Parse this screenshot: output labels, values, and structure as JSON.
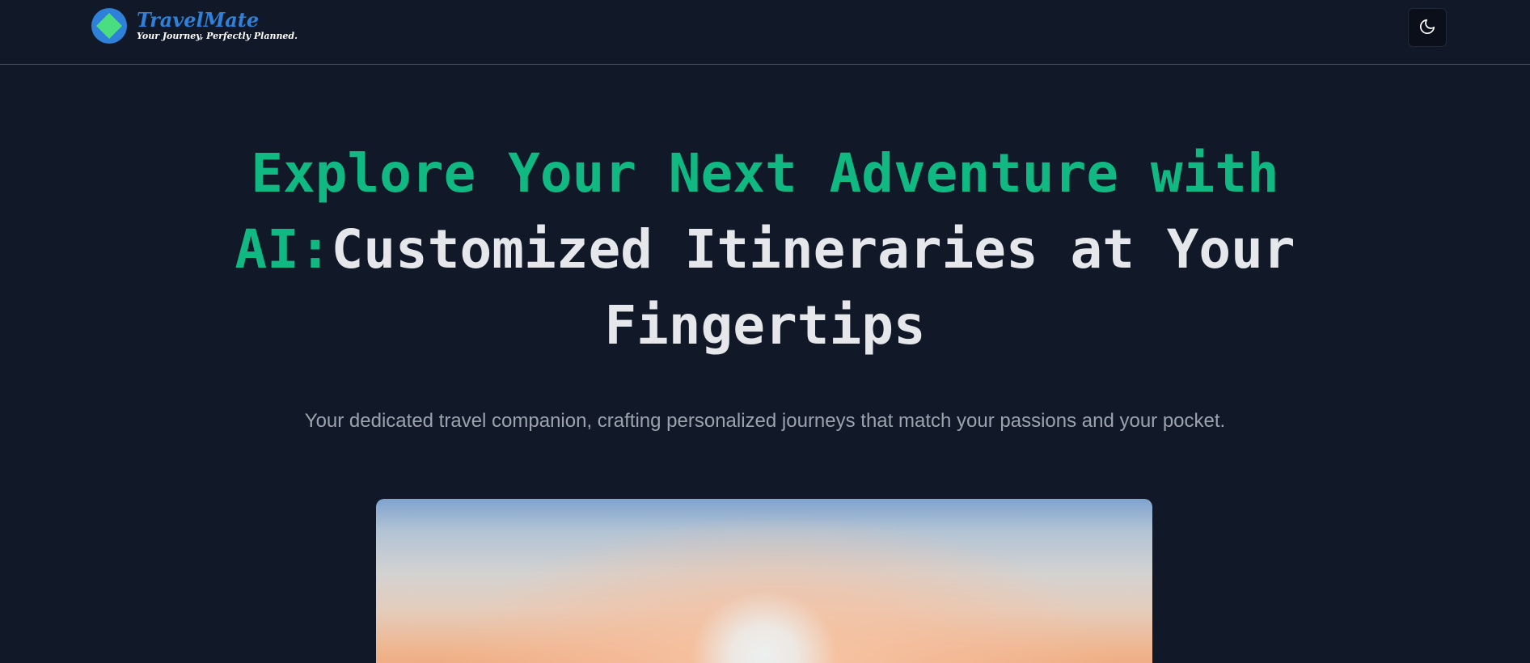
{
  "header": {
    "brand_name": "TravelMate",
    "brand_tagline": "Your Journey, Perfectly Planned.",
    "logo_icon": "diamond-logo-icon",
    "theme_toggle_icon": "moon-icon"
  },
  "hero": {
    "title_accent": "Explore Your Next Adventure with AI:",
    "title_main": "Customized Itineraries at Your Fingertips",
    "subtitle": "Your dedicated travel companion, crafting personalized journeys that match your passions and your pocket.",
    "image_subject": "sunset-sky-image"
  },
  "colors": {
    "background": "#111827",
    "accent_green": "#10b981",
    "brand_blue": "#2f80d9",
    "title_text": "#e5e7eb",
    "subtitle_text": "#9ca3af",
    "divider": "#4b5563"
  }
}
